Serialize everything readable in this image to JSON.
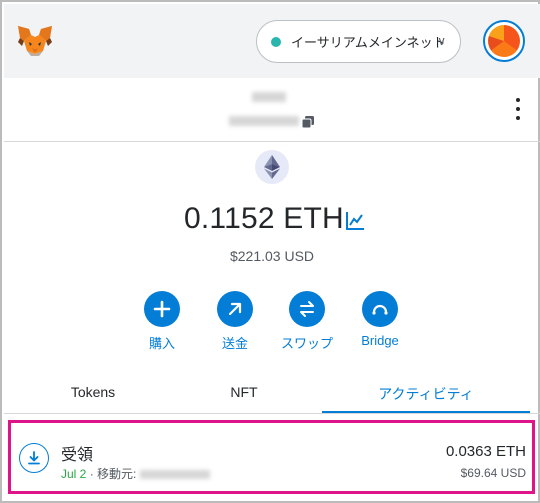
{
  "network": {
    "label": "イーサリアムメインネット",
    "chevron": "∨",
    "status_color": "#29b6af"
  },
  "account": {
    "icons": [
      "copy-icon",
      "more-vertical-icon"
    ]
  },
  "balance": {
    "amount": "0.1152 ETH",
    "fiat": "$221.03 USD",
    "token_icon": "ethereum-icon"
  },
  "actions": [
    {
      "label": "購入",
      "icon": "plus-icon"
    },
    {
      "label": "送金",
      "icon": "arrow-up-right-icon"
    },
    {
      "label": "スワップ",
      "icon": "swap-icon"
    },
    {
      "label": "Bridge",
      "icon": "bridge-icon"
    }
  ],
  "tabs": [
    {
      "label": "Tokens",
      "active": false
    },
    {
      "label": "NFT",
      "active": false
    },
    {
      "label": "アクティビティ",
      "active": true
    }
  ],
  "transaction": {
    "title": "受領",
    "date": "Jul 2",
    "separator": " · ",
    "from_label": "移動元:",
    "amount": "0.0363 ETH",
    "fiat": "$69.64 USD",
    "icon": "receive-icon"
  },
  "colors": {
    "accent": "#037dd6",
    "highlight_border": "#e0148a",
    "date_green": "#28a745"
  }
}
